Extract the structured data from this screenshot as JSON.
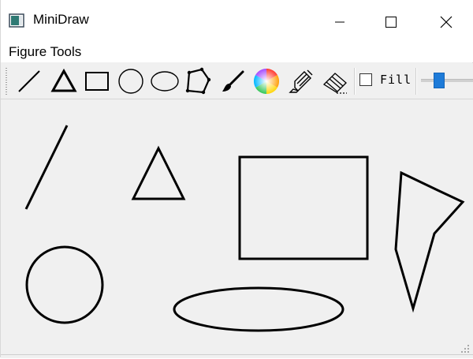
{
  "window": {
    "title": "MiniDraw",
    "app_icon": "window-app-icon",
    "controls": [
      "minimize-icon",
      "maximize-icon",
      "close-icon"
    ]
  },
  "menu": {
    "items": [
      {
        "label": "Figure Tools"
      }
    ]
  },
  "toolbar": {
    "tools": [
      {
        "name": "line-tool",
        "icon": "line-icon"
      },
      {
        "name": "triangle-tool",
        "icon": "triangle-icon"
      },
      {
        "name": "rectangle-tool",
        "icon": "rectangle-icon"
      },
      {
        "name": "circle-tool",
        "icon": "circle-icon"
      },
      {
        "name": "ellipse-tool",
        "icon": "ellipse-icon"
      },
      {
        "name": "polygon-tool",
        "icon": "polygon-icon"
      },
      {
        "name": "brush-tool",
        "icon": "brush-icon"
      },
      {
        "name": "color-picker",
        "icon": "color-wheel-icon"
      },
      {
        "name": "highlighter-tool",
        "icon": "highlighter-icon"
      },
      {
        "name": "eraser-tool",
        "icon": "eraser-icon"
      }
    ],
    "fill_label": "Fill",
    "fill_checked": false,
    "slider_icon": "pen-width-slider"
  },
  "canvas": {
    "background": "#f0f0f0",
    "stroke_color": "#000000",
    "shapes": [
      "line",
      "triangle",
      "rectangle",
      "polygon",
      "circle",
      "ellipse"
    ]
  },
  "colors": {
    "accent": "#1e7bd8",
    "titlebar": "#ffffff",
    "workspace": "#f0f0f0"
  }
}
